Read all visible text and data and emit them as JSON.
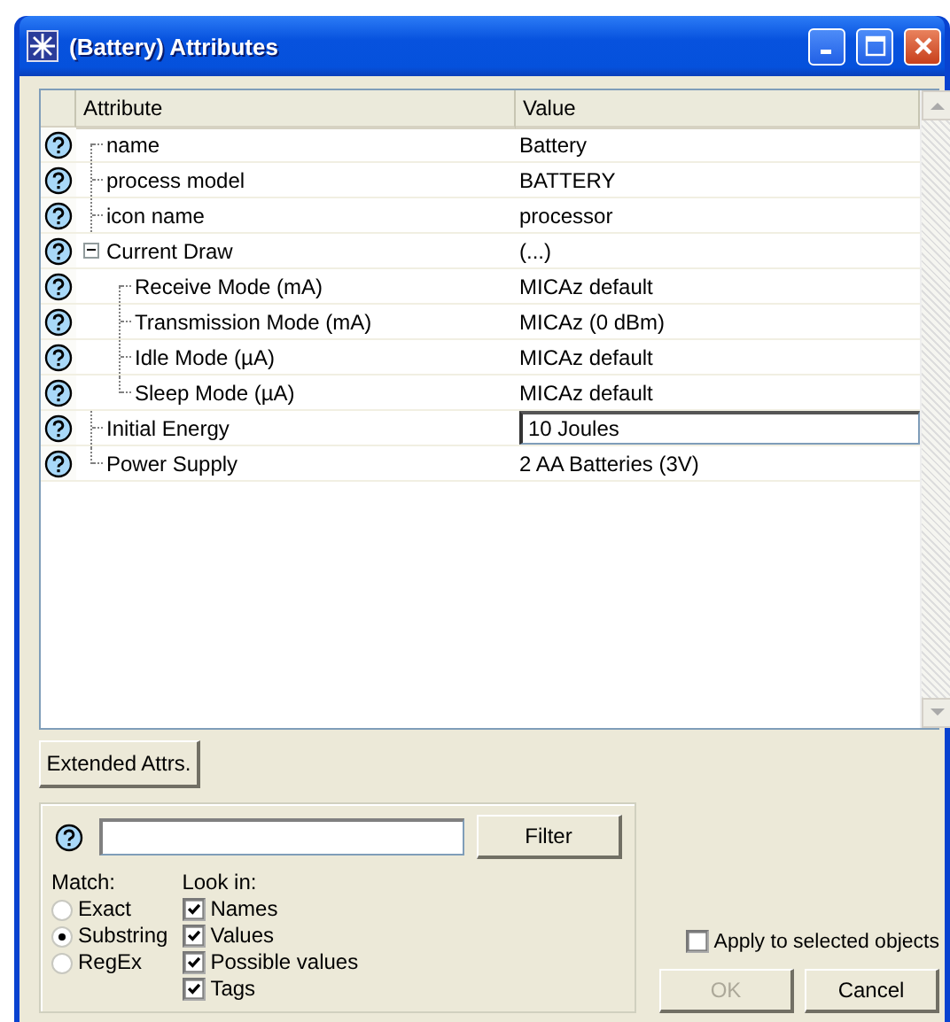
{
  "window": {
    "title": "(Battery) Attributes"
  },
  "table": {
    "columns": [
      "Attribute",
      "Value"
    ],
    "rows": [
      {
        "name": "name",
        "value": "Battery"
      },
      {
        "name": "process model",
        "value": "BATTERY"
      },
      {
        "name": "icon name",
        "value": "processor"
      },
      {
        "name": "Current Draw",
        "value": "(...)",
        "expanded": true,
        "children": [
          {
            "name": "Receive Mode (mA)",
            "value": "MICAz default"
          },
          {
            "name": "Transmission Mode (mA)",
            "value": "MICAz (0 dBm)"
          },
          {
            "name": "Idle Mode (µA)",
            "value": "MICAz default"
          },
          {
            "name": "Sleep Mode (µA)",
            "value": "MICAz default"
          }
        ]
      },
      {
        "name": "Initial Energy",
        "value": "10 Joules",
        "editing": true
      },
      {
        "name": "Power Supply",
        "value": "2 AA Batteries (3V)"
      }
    ]
  },
  "extended_button": "Extended Attrs.",
  "filter": {
    "button": "Filter",
    "match": {
      "label": "Match:",
      "options": [
        {
          "label": "Exact",
          "selected": false
        },
        {
          "label": "Substring",
          "selected": true
        },
        {
          "label": "RegEx",
          "selected": false
        }
      ]
    },
    "look_in": {
      "label": "Look in:",
      "options": [
        {
          "label": "Names",
          "checked": true
        },
        {
          "label": "Values",
          "checked": true
        },
        {
          "label": "Possible values",
          "checked": true
        },
        {
          "label": "Tags",
          "checked": true
        }
      ]
    }
  },
  "apply": {
    "label": "Apply to selected objects",
    "checked": false
  },
  "buttons": [
    {
      "label": "OK",
      "disabled": true
    },
    {
      "label": "Cancel",
      "disabled": false
    }
  ]
}
